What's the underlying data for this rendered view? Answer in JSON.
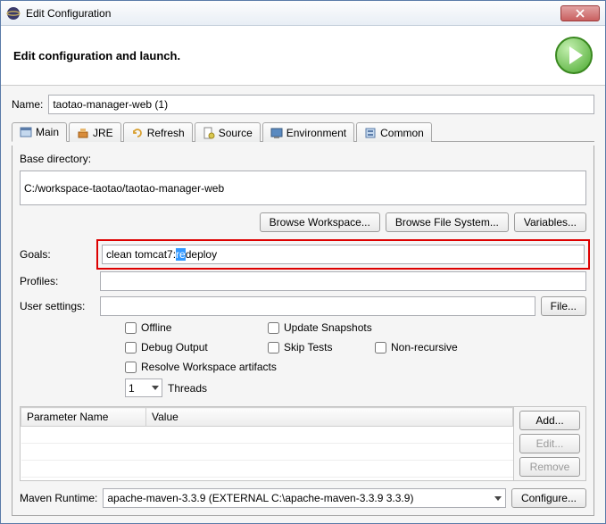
{
  "titlebar": {
    "title": "Edit Configuration"
  },
  "banner": {
    "title": "Edit configuration and launch."
  },
  "name": {
    "label": "Name:",
    "value": "taotao-manager-web (1)"
  },
  "tabs": [
    {
      "label": "Main"
    },
    {
      "label": "JRE"
    },
    {
      "label": "Refresh"
    },
    {
      "label": "Source"
    },
    {
      "label": "Environment"
    },
    {
      "label": "Common"
    }
  ],
  "main": {
    "base_dir_label": "Base directory:",
    "base_dir_value": "C:/workspace-taotao/taotao-manager-web",
    "browse_ws": "Browse Workspace...",
    "browse_fs": "Browse File System...",
    "variables": "Variables...",
    "goals_label": "Goals:",
    "goals_value_pre": "clean tomcat7:",
    "goals_value_sel": "re",
    "goals_value_post": "deploy",
    "profiles_label": "Profiles:",
    "profiles_value": "",
    "user_settings_label": "User settings:",
    "user_settings_value": "",
    "file_btn": "File...",
    "checkboxes": {
      "offline": "Offline",
      "update_snapshots": "Update Snapshots",
      "debug_output": "Debug Output",
      "skip_tests": "Skip Tests",
      "non_recursive": "Non-recursive",
      "resolve_ws": "Resolve Workspace artifacts"
    },
    "threads": {
      "value": "1",
      "label": "Threads"
    },
    "param_table": {
      "col_name": "Parameter Name",
      "col_value": "Value"
    },
    "param_btns": {
      "add": "Add...",
      "edit": "Edit...",
      "remove": "Remove"
    },
    "runtime_label": "Maven Runtime:",
    "runtime_value": "apache-maven-3.3.9 (EXTERNAL C:\\apache-maven-3.3.9 3.3.9)",
    "configure": "Configure..."
  }
}
